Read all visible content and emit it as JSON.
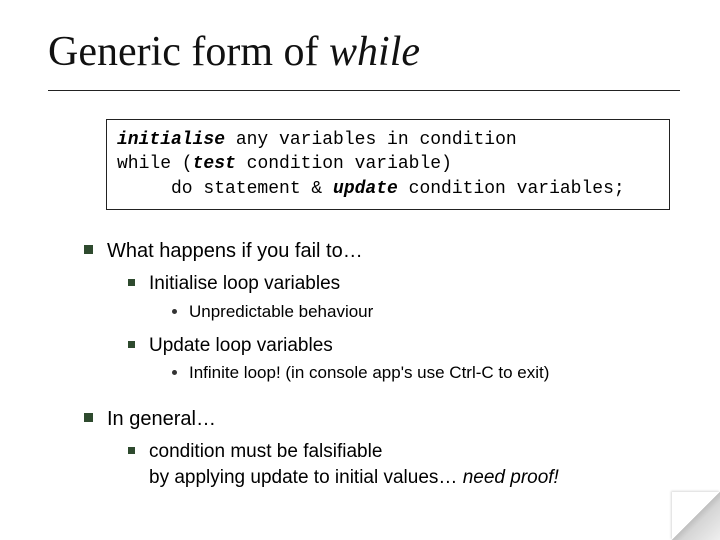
{
  "title": {
    "prefix": "Generic form of ",
    "italic": "while"
  },
  "codebox": {
    "line1": {
      "kw": "initialise",
      "rest": " any variables in condition"
    },
    "line2": "while (",
    "line2_kw": "test",
    "line2_rest": " condition variable)",
    "line3_pre": "do statement & ",
    "line3_kw": "update",
    "line3_post": " condition variables;"
  },
  "bullets": {
    "b1": "What happens if you fail to…",
    "b1a": "Initialise loop variables",
    "b1a1": "Unpredictable behaviour",
    "b1b": "Update loop variables",
    "b1b1": "Infinite loop!  (in console app's use Ctrl-C to exit)",
    "b2": "In general…",
    "b2a_pre": "condition must be falsifiable",
    "b2a_line2_pre": "by applying update to initial values…  ",
    "b2a_line2_it": "need proof!"
  }
}
